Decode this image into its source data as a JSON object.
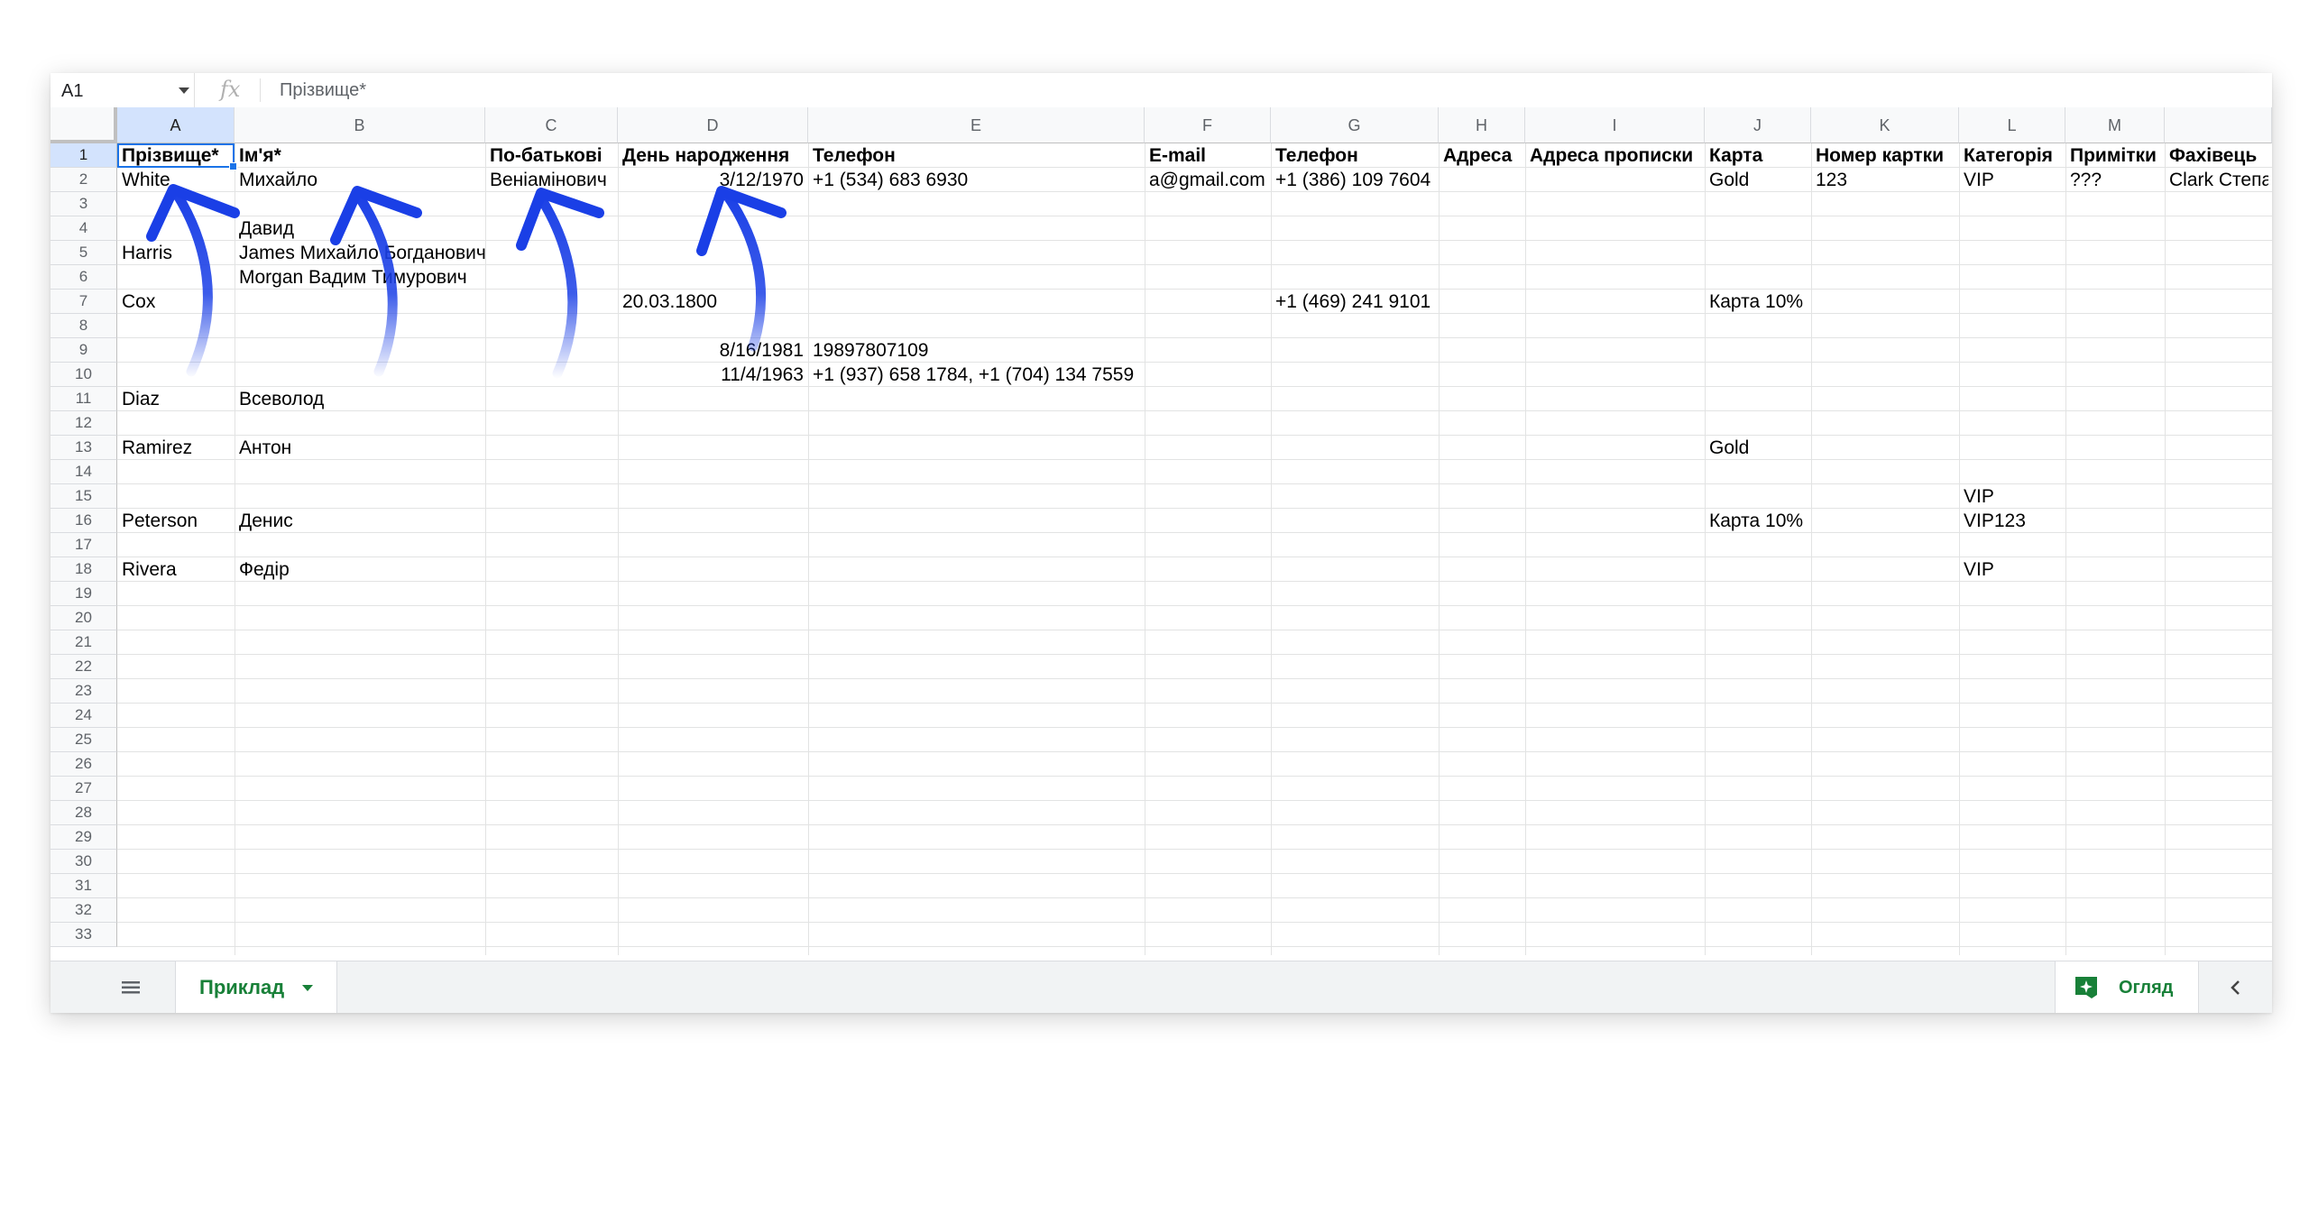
{
  "formula_bar": {
    "name_box": "A1",
    "fx": "fx",
    "value": "Прізвище*"
  },
  "columns": [
    "A",
    "B",
    "C",
    "D",
    "E",
    "F",
    "G",
    "H",
    "I",
    "J",
    "K",
    "L",
    "M",
    ""
  ],
  "rows": [
    1,
    2,
    3,
    4,
    5,
    6,
    7,
    8,
    9,
    10,
    11,
    12,
    13,
    14,
    15,
    16,
    17,
    18,
    19,
    20,
    21,
    22,
    23,
    24,
    25,
    26,
    27,
    28,
    29,
    30,
    31,
    32,
    33
  ],
  "headers": {
    "A": "Прізвище*",
    "B": "Ім'я*",
    "C": "По-батькові",
    "D": "День народження",
    "E": "Телефон",
    "F": "E-mail",
    "G": "Телефон",
    "H": "Адреса",
    "I": "Адреса прописки",
    "J": "Карта",
    "K": "Номер картки",
    "L": "Категорія",
    "M": "Примітки",
    "N": "Фахівець"
  },
  "data": {
    "r2": {
      "A": "White",
      "B": "Михайло",
      "C": "Веніамінович",
      "D": "3/12/1970",
      "E": "+1 (534) 683 6930",
      "F": "a@gmail.com",
      "G": "+1 (386) 109 7604",
      "J": "Gold",
      "K": "123",
      "L": "VIP",
      "M": "???",
      "N": "Clark Степан"
    },
    "r4": {
      "B": "Давид"
    },
    "r5": {
      "A": "Harris",
      "B": "James Михайло Богданович"
    },
    "r6": {
      "B": "Morgan Вадим Тимурович"
    },
    "r7": {
      "A": "Cox",
      "D": "20.03.1800",
      "G": "+1 (469) 241 9101",
      "J": "Карта 10%"
    },
    "r9": {
      "D": "8/16/1981",
      "E": "19897807109"
    },
    "r10": {
      "D": "11/4/1963",
      "E": "+1 (937) 658 1784, +1 (704) 134 7559"
    },
    "r11": {
      "A": "Diaz",
      "B": "Всеволод"
    },
    "r13": {
      "A": "Ramirez",
      "B": "Антон",
      "J": "Gold"
    },
    "r15": {
      "L": "VIP"
    },
    "r16": {
      "A": "Peterson",
      "B": "Денис",
      "J": "Карта 10%",
      "L": "VIP123"
    },
    "r18": {
      "A": "Rivera",
      "B": "Федір",
      "L": "VIP"
    }
  },
  "tab_bar": {
    "sheet_name": "Приклад",
    "explore_label": "Огляд"
  },
  "colors": {
    "accent_green": "#188038",
    "selection_blue": "#1a73e8",
    "annotation_blue": "#1a3fe6"
  }
}
